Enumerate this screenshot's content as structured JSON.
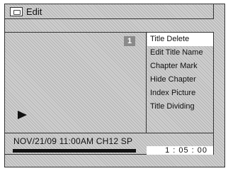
{
  "header": {
    "icon": "edit-icon",
    "title": "Edit"
  },
  "preview": {
    "title_number": "1",
    "play_icon": "play-icon"
  },
  "menu": {
    "items": [
      {
        "label": "Title Delete",
        "selected": true
      },
      {
        "label": "Edit Title Name",
        "selected": false
      },
      {
        "label": "Chapter Mark",
        "selected": false
      },
      {
        "label": "Hide Chapter",
        "selected": false
      },
      {
        "label": "Index Picture",
        "selected": false
      },
      {
        "label": "Title Dividing",
        "selected": false
      }
    ]
  },
  "info": {
    "timestamp": "NOV/21/09 11:00AM CH12 SP",
    "elapsed_time": "1 : 05 : 00"
  }
}
